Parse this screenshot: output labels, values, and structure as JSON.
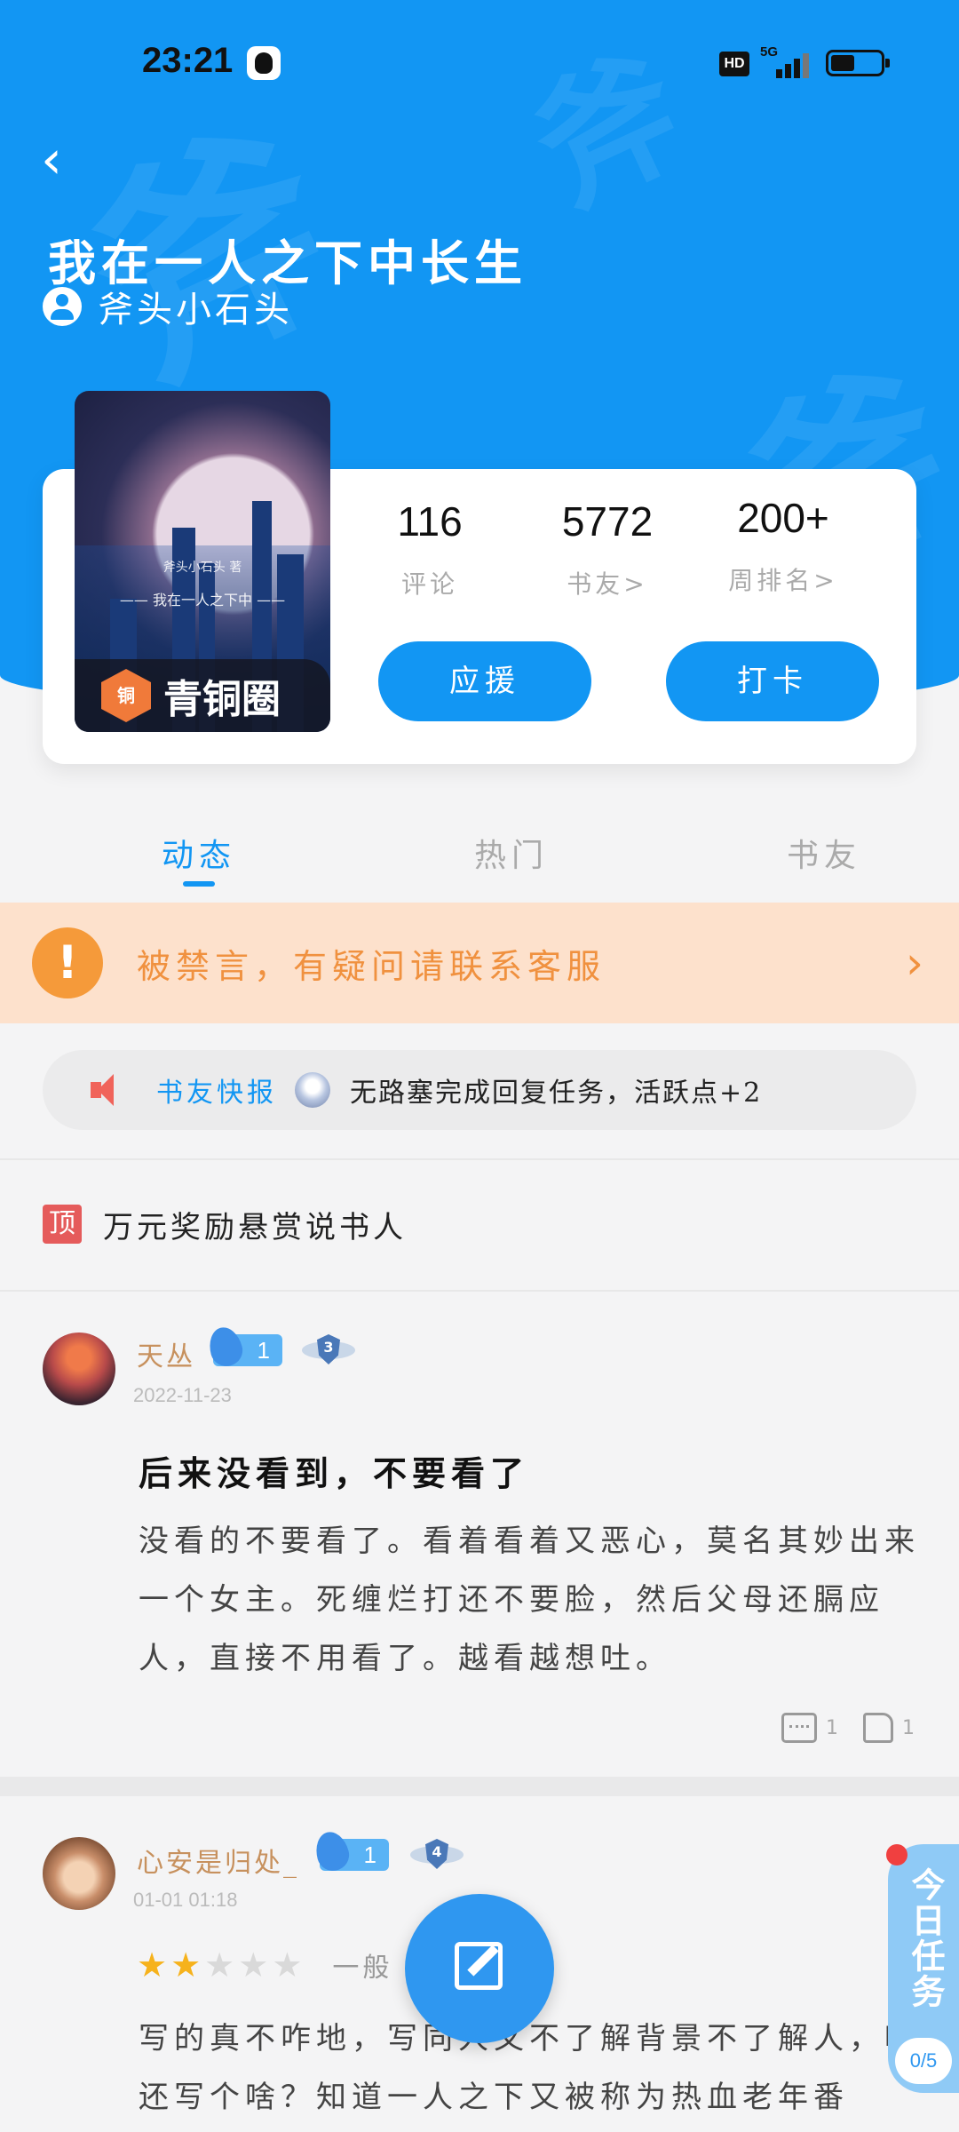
{
  "status_bar": {
    "time": "23:21",
    "hd": "HD",
    "network": "5G"
  },
  "header": {
    "back_icon": "chevron-left-icon",
    "title": "我在一人之下中长生",
    "author": "斧头小石头",
    "watermark": "斧"
  },
  "book": {
    "cover_author": "斧头小石头 著",
    "cover_title": "—— 我在一人之下中 ——",
    "badge_icon_text": "铜",
    "badge_label": "青铜圈"
  },
  "stats": [
    {
      "value": "116",
      "label": "评论"
    },
    {
      "value": "5772",
      "label": "书友>"
    },
    {
      "value": "200+",
      "label": "周排名>"
    }
  ],
  "buttons": {
    "support": "应援",
    "checkin": "打卡"
  },
  "tabs": [
    {
      "label": "动态",
      "active": true
    },
    {
      "label": "热门",
      "active": false
    },
    {
      "label": "书友",
      "active": false
    }
  ],
  "ban_notice": {
    "icon": "!",
    "text": "被禁言，有疑问请联系客服",
    "arrow": "›"
  },
  "news": {
    "tag": "书友快报",
    "text": "无路塞完成回复任务，活跃点+2"
  },
  "pinned": {
    "tag": "顶",
    "text": "万元奖励悬赏说书人"
  },
  "posts": [
    {
      "user": "天丛",
      "fire_level": "1",
      "shield_level": "3",
      "date": "2022-11-23",
      "title": "后来没看到，不要看了",
      "body": "没看的不要看了。看着看着又恶心，莫名其妙出来一个女主。死缠烂打还不要脸，然后父母还膈应人，直接不用看了。越看越想吐。",
      "comments": "1",
      "likes": "1"
    },
    {
      "user": "心安是归处_",
      "fire_level": "1",
      "shield_level": "4",
      "date": "01-01 01:18",
      "rating": 2,
      "rating_label": "一般",
      "body": "写的真不咋地，写同人又不了解背景不了解人，哪还写个啥？知道一人之下又被称为热血老年番"
    }
  ],
  "task": {
    "label": "今日任务",
    "count": "0/5"
  },
  "colors": {
    "primary": "#1296f3",
    "ban_bg": "#fde1cc",
    "ban_text": "#f0913f",
    "username": "#c7915e"
  }
}
